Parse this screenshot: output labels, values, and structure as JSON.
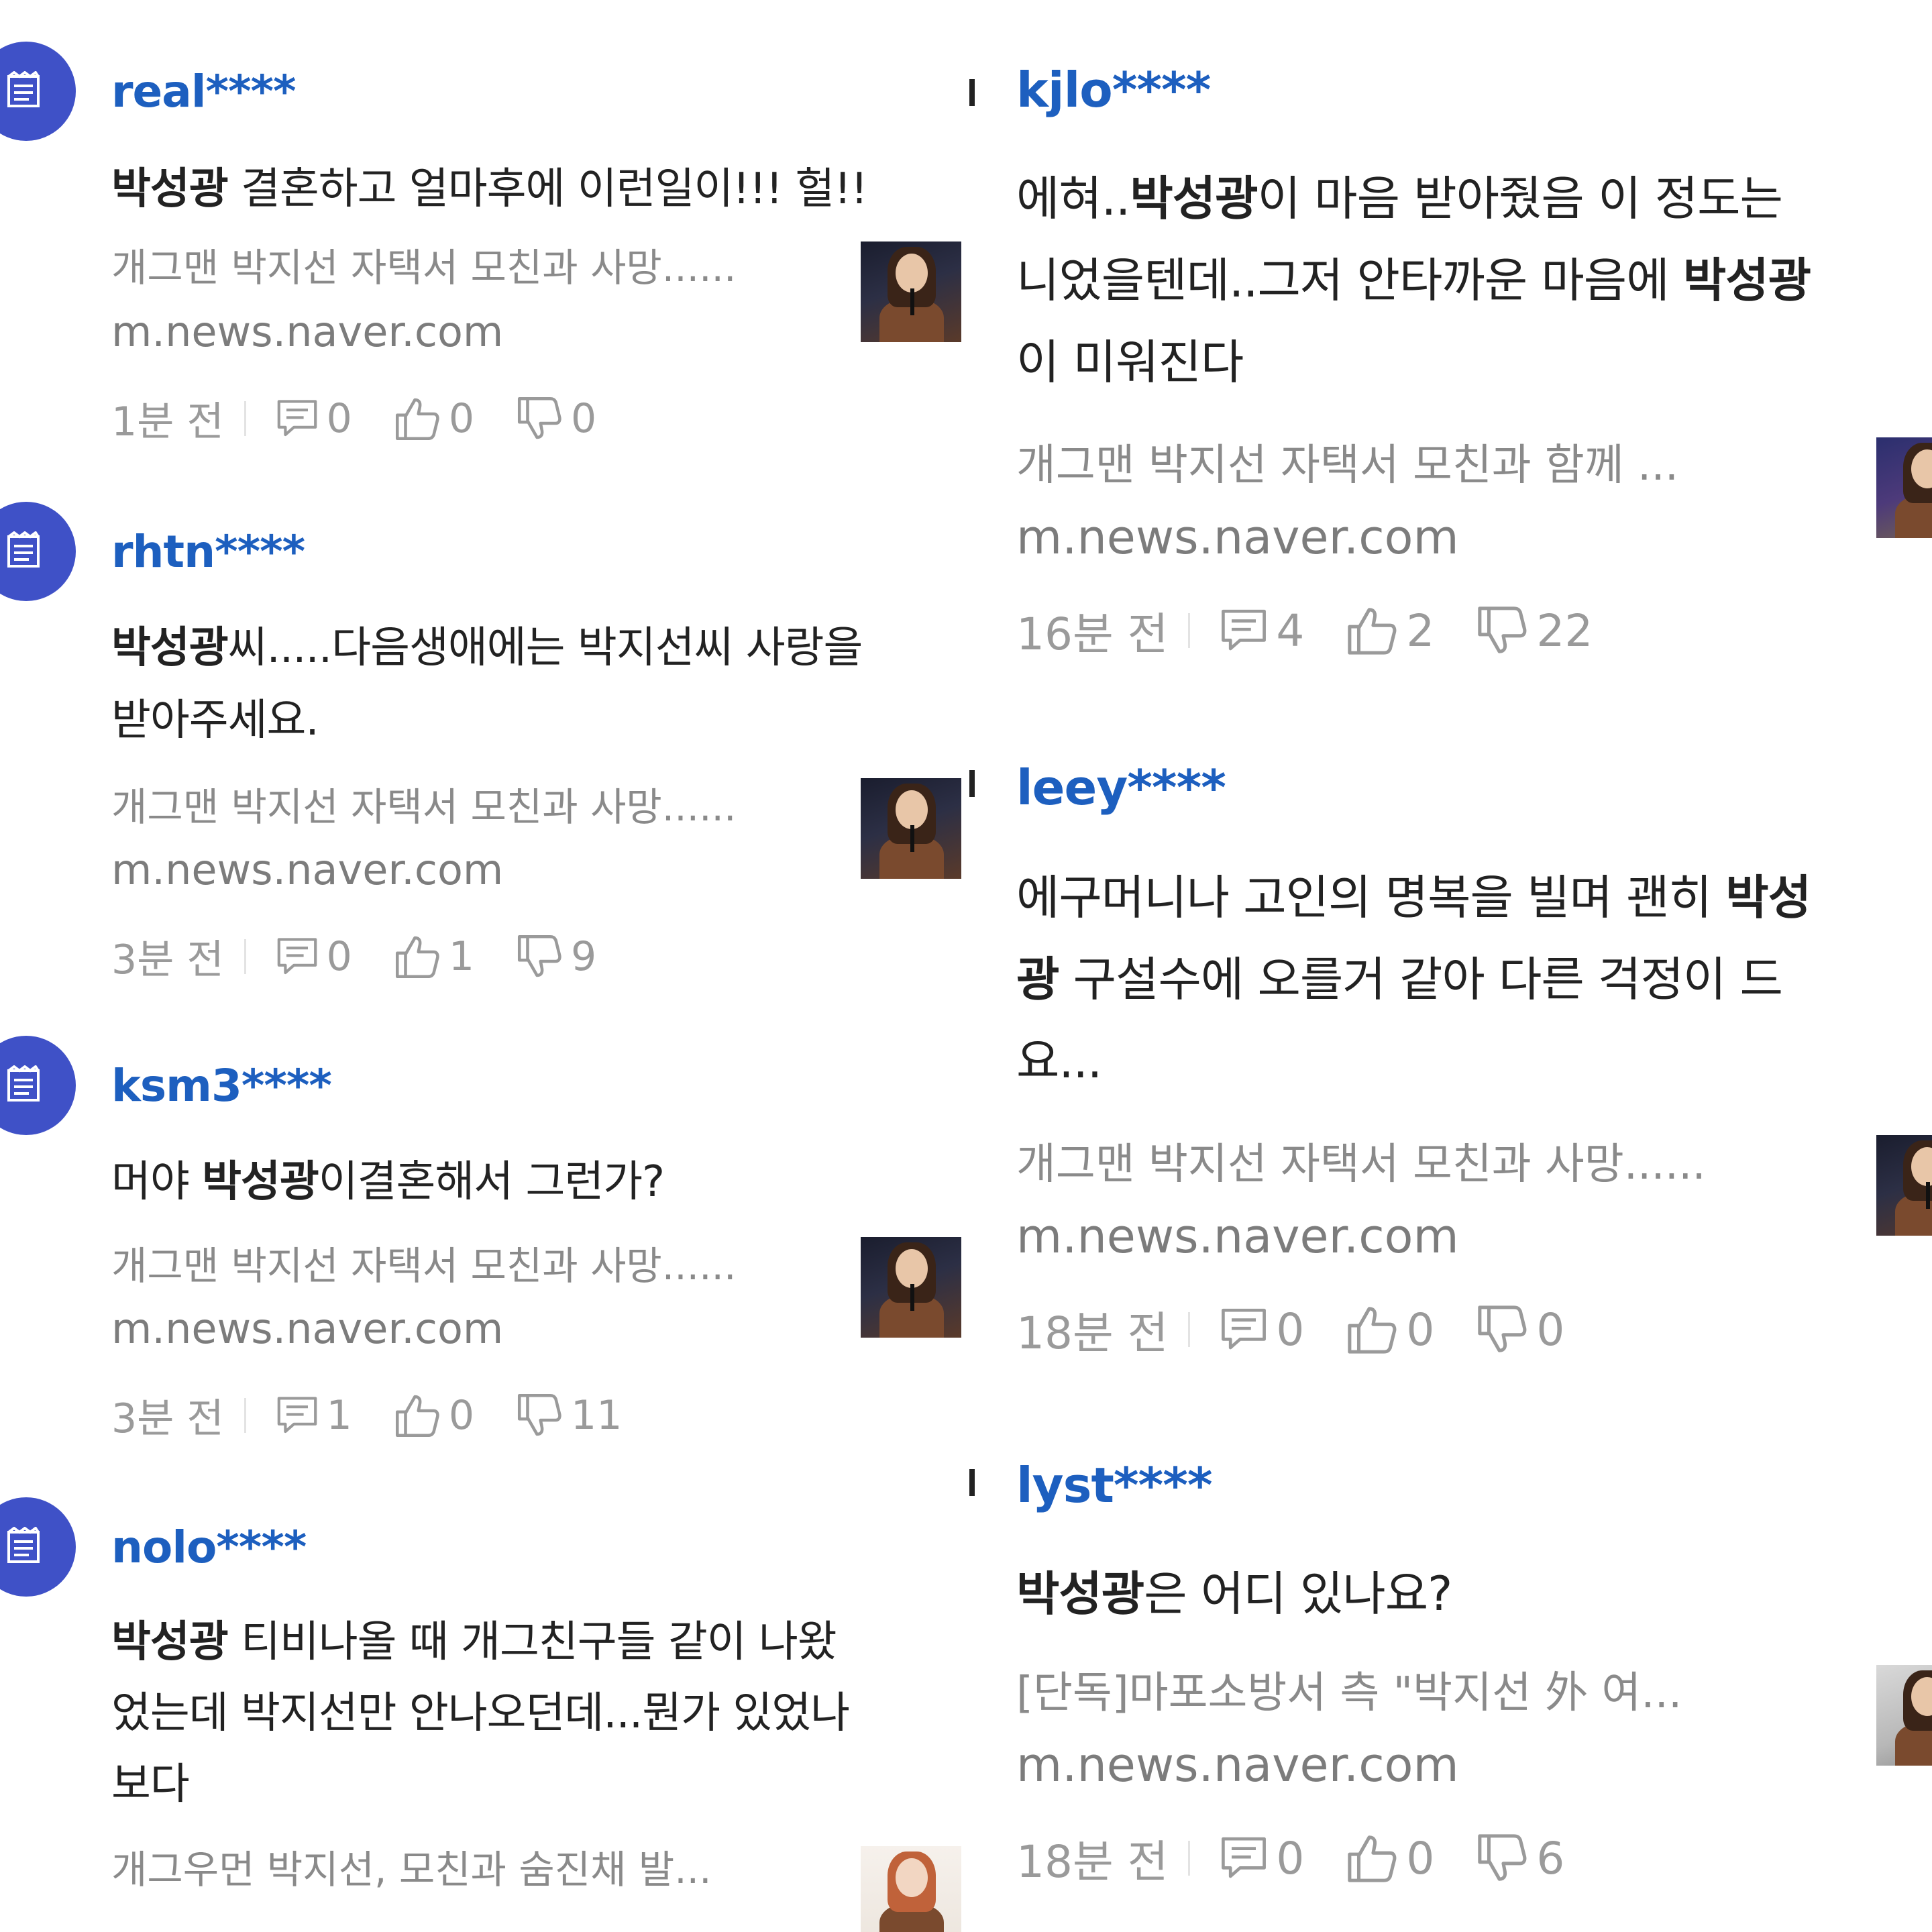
{
  "left_comments": [
    {
      "username": "real****",
      "text_parts": [
        "박성광",
        " 결혼하고 얼마후에 이런일이!!! 헐!!"
      ],
      "link_title": "개그맨 박지선 자택서 모친과 사망......",
      "link_domain": "m.news.naver.com",
      "time": "1분 전",
      "replies": "0",
      "likes": "0",
      "dislikes": "0"
    },
    {
      "username": "rhtn****",
      "text_line1_parts": [
        "박성광",
        "씨.....다음생애에는 박지선씨 사랑을"
      ],
      "text_line2": "받아주세요.",
      "link_title": "개그맨 박지선 자택서 모친과 사망......",
      "link_domain": "m.news.naver.com",
      "time": "3분 전",
      "replies": "0",
      "likes": "1",
      "dislikes": "9"
    },
    {
      "username": "ksm3****",
      "text_parts": [
        "머야 ",
        "박성광",
        "이결혼해서 그런가?"
      ],
      "link_title": "개그맨 박지선 자택서 모친과 사망......",
      "link_domain": "m.news.naver.com",
      "time": "3분 전",
      "replies": "1",
      "likes": "0",
      "dislikes": "11"
    },
    {
      "username": "nolo****",
      "text_line1_parts": [
        "박성광",
        " 티비나올 때 개그친구들 같이 나왔"
      ],
      "text_line2": "었는데 박지선만 안나오던데...뭔가 있었나",
      "text_line3": "보다",
      "link_title": "개그우먼 박지선, 모친과 숨진채 발..."
    }
  ],
  "right_comments": [
    {
      "username": "kjlo****",
      "text_line1_parts": [
        "에혀..",
        "박성광",
        "이 마음 받아줬음 이 정도는"
      ],
      "text_line2_parts": [
        "니었을텐데..그저 안타까운 마음에 ",
        "박성광"
      ],
      "text_line3": "이 미워진다",
      "link_title": "개그맨 박지선 자택서 모친과 함께 ...",
      "link_domain": "m.news.naver.com",
      "time": "16분 전",
      "replies": "4",
      "likes": "2",
      "dislikes": "22"
    },
    {
      "username": "leey****",
      "text_line1_parts": [
        "에구머니나 고인의 명복을 빌며 괜히 ",
        "박성"
      ],
      "text_line2_parts": [
        "광",
        " 구설수에 오를거 같아 다른 걱정이 드"
      ],
      "text_line3": "요...",
      "link_title": "개그맨 박지선 자택서 모친과 사망......",
      "link_domain": "m.news.naver.com",
      "time": "18분 전",
      "replies": "0",
      "likes": "0",
      "dislikes": "0"
    },
    {
      "username": "lyst****",
      "text_parts": [
        "박성광",
        "은 어디 있나요?"
      ],
      "link_title": "[단독]마포소방서 측 \"박지선 外 여...",
      "link_domain": "m.news.naver.com",
      "time": "18분 전",
      "replies": "0",
      "likes": "0",
      "dislikes": "6"
    }
  ],
  "colors": {
    "username": "#1d5fbf",
    "avatar": "#3f51c7",
    "muted": "#9a9a9a"
  },
  "icons": {
    "reply": "reply-icon",
    "like": "thumbs-up-icon",
    "dislike": "thumbs-down-icon",
    "avatar": "newspaper-icon"
  }
}
